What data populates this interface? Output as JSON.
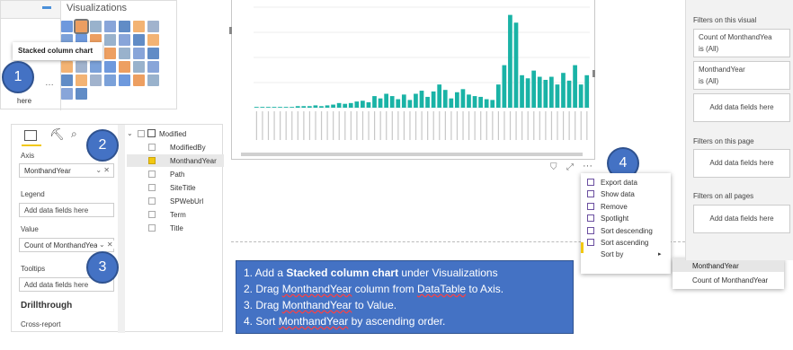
{
  "visualizations": {
    "title": "Visualizations",
    "tooltip": "Stacked column chart",
    "partial_label": "here"
  },
  "fields_panel": {
    "axis_label": "Axis",
    "axis_value": "MonthandYear",
    "legend_label": "Legend",
    "legend_placeholder": "Add data fields here",
    "value_label": "Value",
    "value_value": "Count of MonthandYear",
    "tooltips_label": "Tooltips",
    "tooltips_placeholder": "Add data fields here",
    "drillthrough_label": "Drillthrough",
    "crossreport_label": "Cross-report"
  },
  "field_list": {
    "table": "Modified",
    "items": [
      {
        "name": "ModifiedBy",
        "checked": false
      },
      {
        "name": "MonthandYear",
        "checked": true
      },
      {
        "name": "Path",
        "checked": false
      },
      {
        "name": "SiteTitle",
        "checked": false
      },
      {
        "name": "SPWebUrl",
        "checked": false
      },
      {
        "name": "Term",
        "checked": false
      },
      {
        "name": "Title",
        "checked": false
      }
    ]
  },
  "steps": [
    "1",
    "2",
    "3",
    "4"
  ],
  "chart_data": {
    "type": "bar",
    "values": [
      1,
      1,
      1,
      1,
      1,
      1,
      1,
      2,
      2,
      2,
      3,
      2,
      3,
      4,
      6,
      5,
      6,
      8,
      9,
      7,
      15,
      12,
      18,
      15,
      11,
      17,
      10,
      18,
      22,
      14,
      21,
      30,
      23,
      12,
      20,
      24,
      17,
      15,
      14,
      11,
      10,
      30,
      55,
      120,
      110,
      42,
      38,
      48,
      40,
      36,
      40,
      30,
      45,
      35,
      55,
      30,
      42
    ],
    "color": "#1ab3a6",
    "ylim": [
      0,
      130
    ]
  },
  "context_menu": {
    "items": [
      {
        "label": "Export data",
        "icon": "export-icon"
      },
      {
        "label": "Show data",
        "icon": "table-icon"
      },
      {
        "label": "Remove",
        "icon": "close-icon"
      },
      {
        "label": "Spotlight",
        "icon": "spotlight-icon"
      },
      {
        "label": "Sort descending",
        "icon": "sort-descending-icon"
      },
      {
        "label": "Sort ascending",
        "icon": "sort-ascending-icon"
      },
      {
        "label": "Sort by",
        "icon": ""
      }
    ],
    "submenu": [
      "MonthandYear",
      "Count of MonthandYear"
    ]
  },
  "filters": {
    "on_visual": "Filters on this visual",
    "card1_title": "Count of MonthandYea",
    "card1_sub": "is (All)",
    "card2_title": "MonthandYear",
    "card2_sub": "is (All)",
    "add_fields": "Add data fields here",
    "on_page": "Filters on this page",
    "all_pages": "Filters on all pages"
  },
  "instructions": {
    "l1_pre": "1.  Add a ",
    "l1_bold": "Stacked column chart",
    "l1_post": " under Visualizations",
    "l2_pre": "2.  Drag  ",
    "l2_u1": "MonthandYear",
    "l2_mid": " column from ",
    "l2_u2": "DataTable",
    "l2_post": " to Axis.",
    "l3_pre": "3.  Drag ",
    "l3_u": "MonthandYear",
    "l3_post": " to Value.",
    "l4_pre": "4.  Sort ",
    "l4_u": "MonthandYear",
    "l4_post": " by ascending order."
  }
}
